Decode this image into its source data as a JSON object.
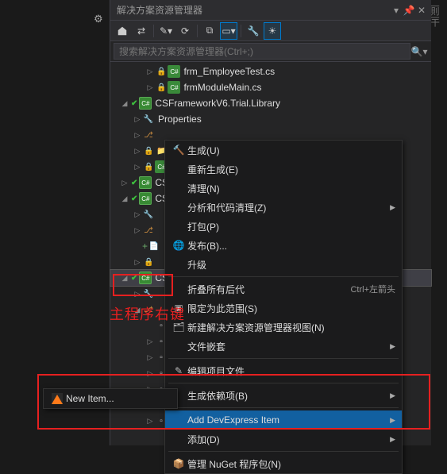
{
  "panel": {
    "title": "解决方案资源管理器"
  },
  "search": {
    "placeholder": "搜索解决方案资源管理器(Ctrl+;)"
  },
  "tree": {
    "file1": "frm_EmployeeTest.cs",
    "file2": "frmModuleMain.cs",
    "proj1": "CSFrameworkV6.Trial.Library",
    "props": "Properties",
    "csi_generic": "CSI",
    "csf_prefix": "CSF"
  },
  "context_menu": {
    "build": "生成(U)",
    "rebuild": "重新生成(E)",
    "clean": "清理(N)",
    "analyze": "分析和代码清理(Z)",
    "pack": "打包(P)",
    "publish": "发布(B)...",
    "upgrade": "升级",
    "collapse": "折叠所有后代",
    "collapse_shortcut": "Ctrl+左箭头",
    "scope": "限定为此范围(S)",
    "newview": "新建解决方案资源管理器视图(N)",
    "nesting": "文件嵌套",
    "editproj": "编辑项目文件",
    "builddep": "生成依赖项(B)",
    "add_dx": "Add DevExpress Item",
    "add": "添加(D)",
    "nuget": "管理 NuGet 程序包(N)"
  },
  "submenu": {
    "newitem": "New Item..."
  },
  "annotation": {
    "label": "主程序右键"
  }
}
